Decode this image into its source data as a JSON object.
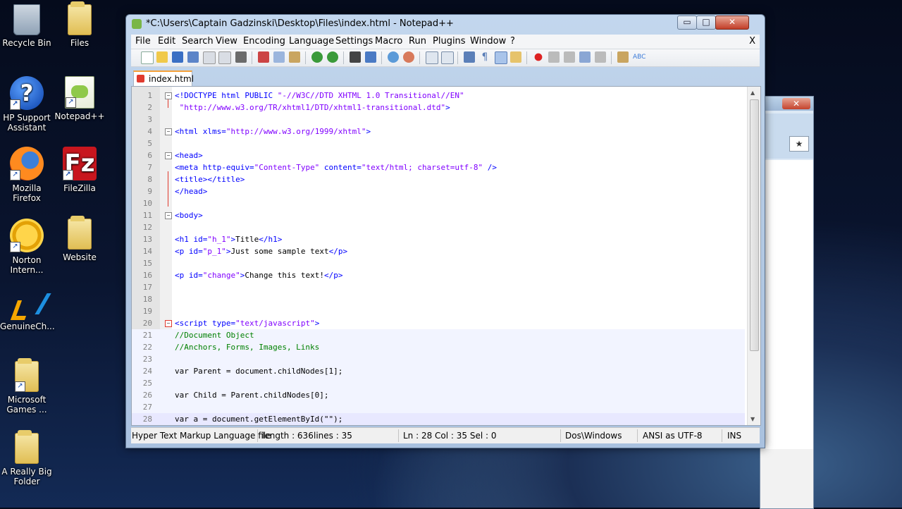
{
  "desktop": {
    "icons": [
      {
        "label": "Recycle Bin",
        "icon": "recycle-bin-icon"
      },
      {
        "label": "Files",
        "icon": "folder-icon"
      },
      {
        "label": "HP Support Assistant",
        "icon": "help-icon"
      },
      {
        "label": "Notepad++",
        "icon": "notepad-plus-plus-icon"
      },
      {
        "label": "Mozilla Firefox",
        "icon": "firefox-icon"
      },
      {
        "label": "FileZilla",
        "icon": "filezilla-icon"
      },
      {
        "label": "Norton Intern...",
        "icon": "norton-icon"
      },
      {
        "label": "Website",
        "icon": "folder-icon"
      },
      {
        "label": "GenuineCh...",
        "icon": "genuine-check-icon"
      },
      {
        "label": "Microsoft Games ...",
        "icon": "folder-icon"
      },
      {
        "label": "A Really Big Folder",
        "icon": "folder-icon"
      }
    ]
  },
  "window": {
    "title": "*C:\\Users\\Captain Gadzinski\\Desktop\\Files\\index.html - Notepad++",
    "minimize": "▭",
    "maximize": "□",
    "close": "✕"
  },
  "menu": {
    "items": [
      "File",
      "Edit",
      "Search",
      "View",
      "Encoding",
      "Language",
      "Settings",
      "Macro",
      "Run",
      "Plugins",
      "Window",
      "?"
    ],
    "close_doc": "X"
  },
  "tabs": [
    {
      "label": "index.html",
      "active": true
    }
  ],
  "editor": {
    "cursor_line": 28,
    "lines": [
      {
        "n": 1,
        "text": "<!DOCTYPE html PUBLIC \"-//W3C//DTD XHTML 1.0 Transitional//EN\""
      },
      {
        "n": 2,
        "text": "\"http://www.w3.org/TR/xhtml1/DTD/xhtml1-transitional.dtd\">"
      },
      {
        "n": 3,
        "text": ""
      },
      {
        "n": 4,
        "text": "<html xlms=\"http://www.w3.org/1999/xhtml\">"
      },
      {
        "n": 5,
        "text": ""
      },
      {
        "n": 6,
        "text": "<head>"
      },
      {
        "n": 7,
        "text": "<meta http-equiv=\"Content-Type\" content=\"text/html; charset=utf-8\" />"
      },
      {
        "n": 8,
        "text": "<title></title>"
      },
      {
        "n": 9,
        "text": "</head>"
      },
      {
        "n": 10,
        "text": ""
      },
      {
        "n": 11,
        "text": "<body>"
      },
      {
        "n": 12,
        "text": ""
      },
      {
        "n": 13,
        "text": "<h1 id=\"h_1\">Title</h1>"
      },
      {
        "n": 14,
        "text": "<p id=\"p_1\">Just some sample text</p>"
      },
      {
        "n": 15,
        "text": ""
      },
      {
        "n": 16,
        "text": "<p id=\"change\">Change this text!</p>"
      },
      {
        "n": 17,
        "text": ""
      },
      {
        "n": 18,
        "text": ""
      },
      {
        "n": 19,
        "text": ""
      },
      {
        "n": 20,
        "text": "<script type=\"text/javascript\">"
      },
      {
        "n": 21,
        "text": "//Document Object"
      },
      {
        "n": 22,
        "text": "//Anchors, Forms, Images, Links"
      },
      {
        "n": 23,
        "text": ""
      },
      {
        "n": 24,
        "text": "var Parent = document.childNodes[1];"
      },
      {
        "n": 25,
        "text": ""
      },
      {
        "n": 26,
        "text": "var Child = Parent.childNodes[0];"
      },
      {
        "n": 27,
        "text": ""
      },
      {
        "n": 28,
        "text": "var a = document.getElementById(\"\");"
      }
    ]
  },
  "status": {
    "filetype": "Hyper Text Markup Language file",
    "length": "length : 636",
    "lines": "lines : 35",
    "position": "Ln : 28    Col : 35    Sel : 0",
    "eol": "Dos\\Windows",
    "encoding": "ANSI as UTF-8",
    "mode": "INS"
  },
  "colors": {
    "tag": "#0000ff",
    "attribute": "#ff0000",
    "value": "#8000ff",
    "comment": "#008000",
    "tab_accent": "#f5a13a"
  }
}
